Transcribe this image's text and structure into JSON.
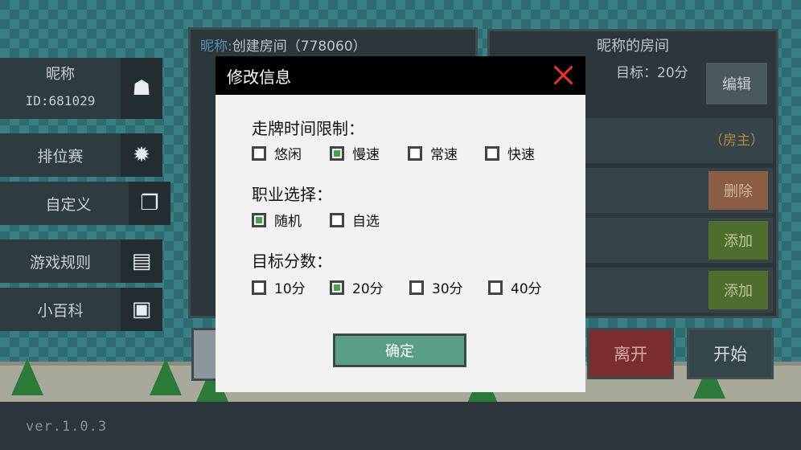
{
  "version": "ver.1.0.3",
  "sidebar": {
    "profile": {
      "name": "昵称",
      "id": "ID:681029"
    },
    "items": [
      {
        "label": "排位赛",
        "icon": "gear-icon"
      },
      {
        "label": "自定义",
        "icon": "copy-icon"
      },
      {
        "label": "游戏规则",
        "icon": "document-icon"
      },
      {
        "label": "小百科",
        "icon": "save-icon"
      }
    ]
  },
  "room_list": {
    "nick_label": "昵称:",
    "title": "创建房间（778060）"
  },
  "room": {
    "title": "昵称的房间",
    "goal": "目标：20分",
    "edit_label": "编辑",
    "host_label": "（房主）",
    "delete_label": "删除",
    "add_label_1": "添加",
    "add_label_2": "添加",
    "leave_label": "离开",
    "start_label": "开始"
  },
  "modal": {
    "title": "修改信息",
    "sections": [
      {
        "title": "走牌时间限制：",
        "options": [
          {
            "label": "悠闲",
            "checked": false
          },
          {
            "label": "慢速",
            "checked": true
          },
          {
            "label": "常速",
            "checked": false
          },
          {
            "label": "快速",
            "checked": false
          }
        ]
      },
      {
        "title": "职业选择：",
        "options": [
          {
            "label": "随机",
            "checked": true
          },
          {
            "label": "自选",
            "checked": false
          }
        ]
      },
      {
        "title": "目标分数：",
        "options": [
          {
            "label": "10分",
            "checked": false
          },
          {
            "label": "20分",
            "checked": true
          },
          {
            "label": "30分",
            "checked": false
          },
          {
            "label": "40分",
            "checked": false
          }
        ]
      }
    ],
    "confirm_label": "确定"
  },
  "colors": {
    "accent": "#5a9e86",
    "checked": "#44a744",
    "close": "#e0382c",
    "host": "#b8853c"
  }
}
